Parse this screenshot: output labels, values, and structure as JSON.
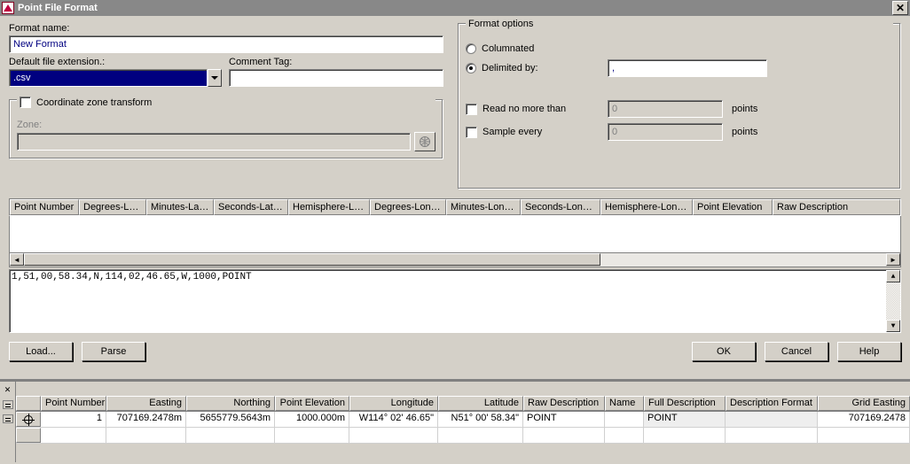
{
  "titlebar": {
    "title": "Point File Format"
  },
  "labels": {
    "format_name": "Format name:",
    "default_ext": "Default file extension.:",
    "comment_tag": "Comment Tag:",
    "coord_zone": "Coordinate zone transform",
    "zone": "Zone:",
    "format_options": "Format options",
    "columnated": "Columnated",
    "delimited_by": "Delimited by:",
    "read_no_more": "Read no more than",
    "sample_every": "Sample every",
    "points": "points"
  },
  "values": {
    "format_name": "New Format",
    "default_ext": ".csv",
    "comment_tag": "",
    "zone": "",
    "delimiter": ",",
    "read_limit": "0",
    "sample": "0",
    "sample_text": "1,51,00,58.34,N,114,02,46.65,W,1000,POINT"
  },
  "columns": [
    "Point Number",
    "Degrees-Lat...",
    "Minutes-Lati...",
    "Seconds-Latit...",
    "Hemisphere-Lat...",
    "Degrees-Long...",
    "Minutes-Longi...",
    "Seconds-Longit...",
    "Hemisphere-Long...",
    "Point Elevation",
    "Raw Description"
  ],
  "buttons": {
    "load": "Load...",
    "parse": "Parse",
    "ok": "OK",
    "cancel": "Cancel",
    "help": "Help"
  },
  "grid": {
    "headers": [
      "Point Number",
      "Easting",
      "Northing",
      "Point Elevation",
      "Longitude",
      "Latitude",
      "Raw Description",
      "Name",
      "Full Description",
      "Description Format",
      "Grid Easting"
    ],
    "row": {
      "point_number": "1",
      "easting": "707169.2478m",
      "northing": "5655779.5643m",
      "elev": "1000.000m",
      "lon": "W114° 02' 46.65\"",
      "lat": "N51° 00' 58.34\"",
      "rawdesc": "POINT",
      "name": "",
      "fulldesc": "POINT",
      "descfmt": "",
      "geasting": "707169.2478"
    }
  }
}
